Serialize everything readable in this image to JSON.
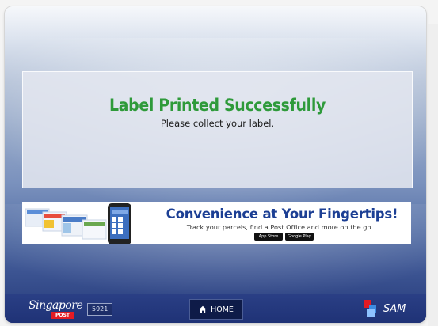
{
  "message": {
    "title": "Label Printed Successfully",
    "subtitle": "Please collect your label."
  },
  "banner": {
    "title": "Convenience at Your Fingertips!",
    "subtitle": "Track your parcels, find a Post Office and more on the go...",
    "badges": [
      "App Store",
      "Google Play"
    ]
  },
  "footer": {
    "logo_script": "Singapore",
    "logo_post": "POST",
    "kiosk_id": "5921",
    "home_label": "HOME",
    "brand": "SAM"
  },
  "colors": {
    "success_green": "#2e9a3a",
    "banner_blue": "#1c3f94",
    "footer_navy": "#1f3276",
    "post_red": "#e31b23"
  }
}
